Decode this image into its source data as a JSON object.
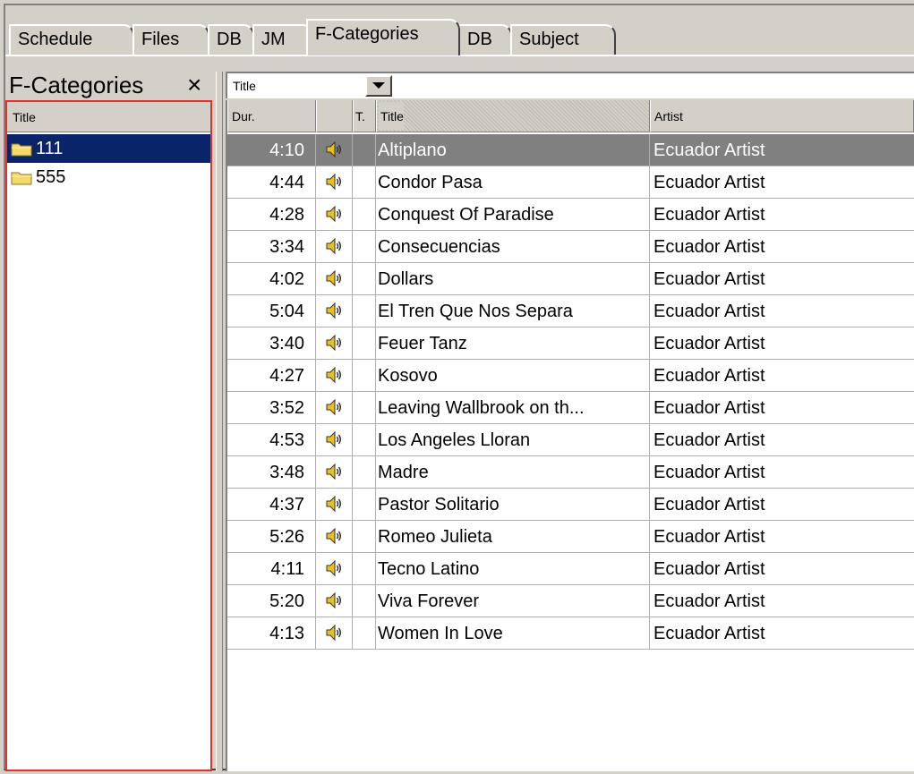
{
  "tabs": [
    {
      "label": "Schedule",
      "active": false
    },
    {
      "label": "Files",
      "active": false
    },
    {
      "label": "DB",
      "active": false
    },
    {
      "label": "JM",
      "active": false
    },
    {
      "label": "F-Categories",
      "active": true
    },
    {
      "label": "DB",
      "active": false
    },
    {
      "label": "Subject",
      "active": false
    }
  ],
  "left_panel": {
    "title": "F-Categories",
    "close_glyph": "×",
    "column_header": "Title",
    "items": [
      {
        "label": "111",
        "icon": "folder-icon",
        "selected": true
      },
      {
        "label": "555",
        "icon": "folder-icon",
        "selected": false
      }
    ]
  },
  "filter": {
    "field_value": "Title",
    "search_value": ""
  },
  "grid": {
    "columns": [
      {
        "key": "dur",
        "label": "Dur."
      },
      {
        "key": "icon",
        "label": ""
      },
      {
        "key": "t",
        "label": "T."
      },
      {
        "key": "title",
        "label": "Title"
      },
      {
        "key": "artist",
        "label": "Artist"
      }
    ],
    "row_icon": "speaker-icon",
    "rows": [
      {
        "dur": "4:10",
        "title": "Altiplano",
        "artist": "Ecuador Artist",
        "selected": true
      },
      {
        "dur": "4:44",
        "title": "Condor Pasa",
        "artist": "Ecuador Artist"
      },
      {
        "dur": "4:28",
        "title": "Conquest Of Paradise",
        "artist": "Ecuador Artist"
      },
      {
        "dur": "3:34",
        "title": "Consecuencias",
        "artist": "Ecuador Artist"
      },
      {
        "dur": "4:02",
        "title": "Dollars",
        "artist": "Ecuador Artist"
      },
      {
        "dur": "5:04",
        "title": "El Tren Que Nos Separa",
        "artist": "Ecuador Artist"
      },
      {
        "dur": "3:40",
        "title": "Feuer Tanz",
        "artist": "Ecuador Artist"
      },
      {
        "dur": "4:27",
        "title": "Kosovo",
        "artist": "Ecuador Artist"
      },
      {
        "dur": "3:52",
        "title": "Leaving Wallbrook on th...",
        "artist": "Ecuador Artist"
      },
      {
        "dur": "4:53",
        "title": "Los Angeles Lloran",
        "artist": "Ecuador Artist"
      },
      {
        "dur": "3:48",
        "title": "Madre",
        "artist": "Ecuador Artist"
      },
      {
        "dur": "4:37",
        "title": "Pastor Solitario",
        "artist": "Ecuador Artist"
      },
      {
        "dur": "5:26",
        "title": "Romeo Julieta",
        "artist": "Ecuador Artist"
      },
      {
        "dur": "4:11",
        "title": "Tecno Latino",
        "artist": "Ecuador Artist"
      },
      {
        "dur": "5:20",
        "title": "Viva Forever",
        "artist": "Ecuador Artist"
      },
      {
        "dur": "4:13",
        "title": "Women In Love",
        "artist": "Ecuador Artist"
      }
    ]
  },
  "colors": {
    "face": "#d4d0c8",
    "selection_tree": "#0a246a",
    "selection_grid": "#808080",
    "pane_outline": "#e03030",
    "folder": "#f5d86a",
    "speaker": "#e8c020"
  }
}
